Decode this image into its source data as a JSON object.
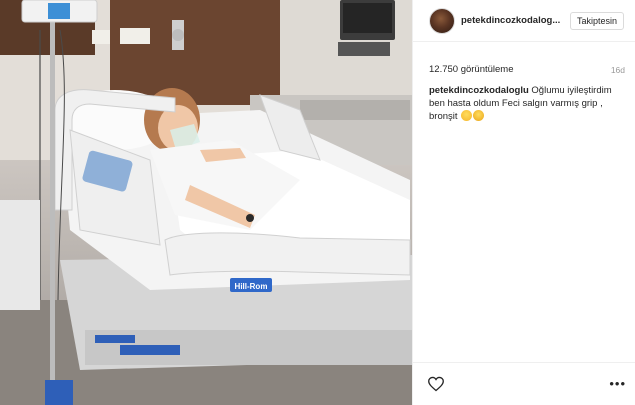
{
  "post": {
    "username": "petekdincozkodalog...",
    "follow_label": "Takiptesin",
    "views": "12.750 görüntüleme",
    "age": "16d",
    "caption_user": "petekdincozkodaloglu",
    "caption_text": "Oğlumu iyileştirdim ben hasta oldum Feci salgın varmış grip , bronşit",
    "media_labels": {
      "bed_brand": "Hill-Rom"
    },
    "icons": [
      "avatar",
      "heart-icon",
      "more-options-icon",
      "emoji-tired",
      "emoji-weary"
    ]
  }
}
